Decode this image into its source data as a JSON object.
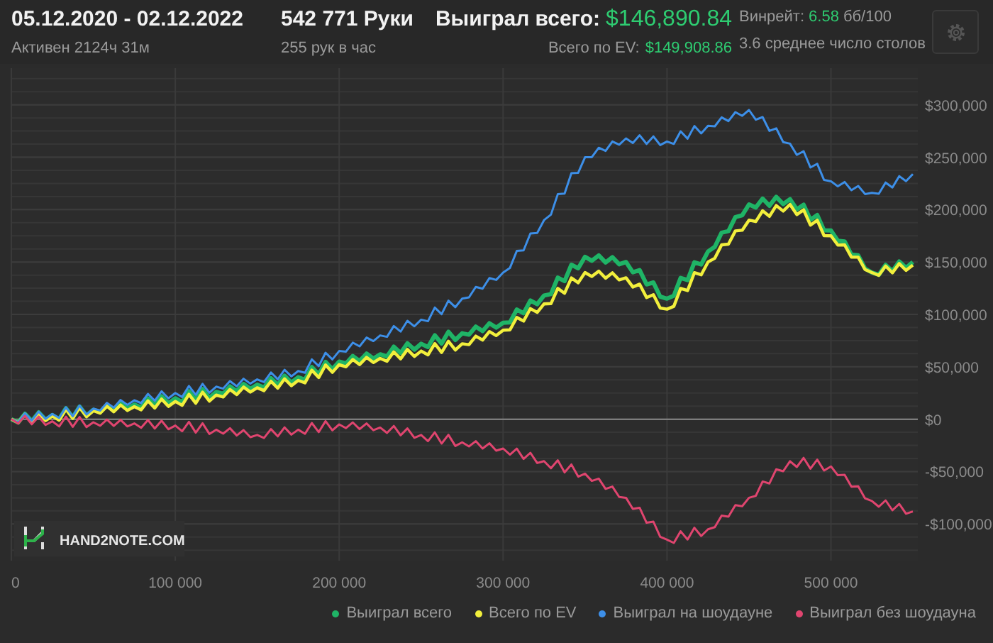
{
  "header": {
    "date_range": "05.12.2020 - 02.12.2022",
    "active": "Активен 2124ч 31м",
    "hands": "542 771 Руки",
    "hands_per_hour": "255 рук в час",
    "won_label": "Выиграл всего:",
    "won_value": "$146,890.84",
    "ev_label": "Всего по EV:",
    "ev_value": "$149,908.86",
    "winrate_label": "Винрейт:",
    "winrate_value": "6.58",
    "winrate_unit": "бб/100",
    "tables": "3.6 среднее число столов"
  },
  "chart": {
    "logo": "HAND2NOTE.COM",
    "chart_data": {
      "type": "line",
      "x": [
        0,
        25000,
        50000,
        75000,
        100000,
        125000,
        150000,
        175000,
        200000,
        225000,
        250000,
        275000,
        300000,
        325000,
        350000,
        375000,
        400000,
        425000,
        450000,
        475000,
        500000,
        525000,
        550000
      ],
      "series": [
        {
          "name": "Выиграл всего",
          "color": "#1fb466",
          "values": [
            0,
            4000,
            9000,
            14000,
            20000,
            26000,
            33000,
            40000,
            55000,
            62000,
            72000,
            82000,
            92000,
            118000,
            155000,
            150000,
            115000,
            160000,
            205000,
            210000,
            180000,
            140000,
            150000
          ]
        },
        {
          "name": "Всего по EV",
          "color": "#f2ef3c",
          "values": [
            0,
            3000,
            8000,
            12000,
            17000,
            23000,
            30000,
            37000,
            52000,
            58000,
            65000,
            72000,
            85000,
            110000,
            140000,
            135000,
            105000,
            150000,
            190000,
            205000,
            175000,
            140000,
            147000
          ]
        },
        {
          "name": "Выиграл на шоудауне",
          "color": "#3d8fe8",
          "values": [
            0,
            5000,
            10000,
            18000,
            25000,
            31000,
            38000,
            46000,
            65000,
            80000,
            95000,
            115000,
            140000,
            190000,
            250000,
            268000,
            265000,
            280000,
            295000,
            263000,
            227000,
            216000,
            234000
          ]
        },
        {
          "name": "Выиграл без шоудауна",
          "color": "#e0456f",
          "values": [
            0,
            -2000,
            -3000,
            -4000,
            -6000,
            -10000,
            -15000,
            -10000,
            -5000,
            -8000,
            -15000,
            -22000,
            -28000,
            -40000,
            -52000,
            -75000,
            -115000,
            -105000,
            -75000,
            -40000,
            -45000,
            -78000,
            -88000
          ]
        }
      ],
      "grid": true,
      "xlim": [
        0,
        553000
      ],
      "ylim": [
        -135000,
        335000
      ],
      "xticks": [
        {
          "value": 0,
          "label": "0"
        },
        {
          "value": 100000,
          "label": "100 000"
        },
        {
          "value": 200000,
          "label": "200 000"
        },
        {
          "value": 300000,
          "label": "300 000"
        },
        {
          "value": 400000,
          "label": "400 000"
        },
        {
          "value": 500000,
          "label": "500 000"
        }
      ],
      "yticks": [
        {
          "value": 300000,
          "label": "$300,000"
        },
        {
          "value": 250000,
          "label": "$250,000"
        },
        {
          "value": 200000,
          "label": "$200,000"
        },
        {
          "value": 150000,
          "label": "$150,000"
        },
        {
          "value": 100000,
          "label": "$100,000"
        },
        {
          "value": 50000,
          "label": "$50,000"
        },
        {
          "value": 0,
          "label": "$0"
        },
        {
          "value": -50000,
          "label": "-$50,000"
        },
        {
          "value": -100000,
          "label": "-$100,000"
        }
      ]
    }
  }
}
